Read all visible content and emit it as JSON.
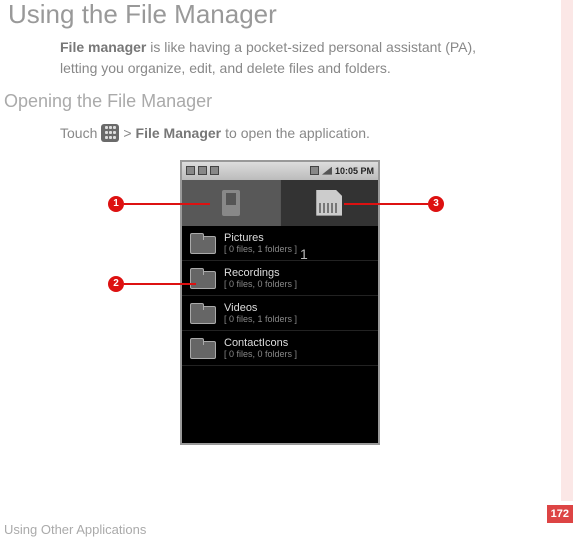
{
  "page": {
    "title": "Using the File Manager",
    "intro_bold": "File manager",
    "intro_rest": " is like having a pocket-sized personal assistant (PA), letting you organize, edit, and delete files and folders.",
    "sub_heading": "Opening the File Manager",
    "instruction_pre": "Touch ",
    "instruction_sep": " > ",
    "instruction_bold": "File Manager",
    "instruction_post": " to open the application.",
    "footer": "Using Other Applications",
    "page_number": "172"
  },
  "phone": {
    "status_time": "10:05 PM",
    "folders": [
      {
        "name": "Pictures",
        "meta": "[ 0 files, 1 folders   ]"
      },
      {
        "name": "Recordings",
        "meta": "[ 0 files, 0 folders   ]"
      },
      {
        "name": "Videos",
        "meta": "[ 0 files, 1 folders   ]"
      },
      {
        "name": "ContactIcons",
        "meta": "[ 0 files, 0 folders   ]"
      }
    ]
  },
  "callouts": {
    "c1": "1",
    "c2": "2",
    "c3": "3",
    "overlay1": "1"
  }
}
